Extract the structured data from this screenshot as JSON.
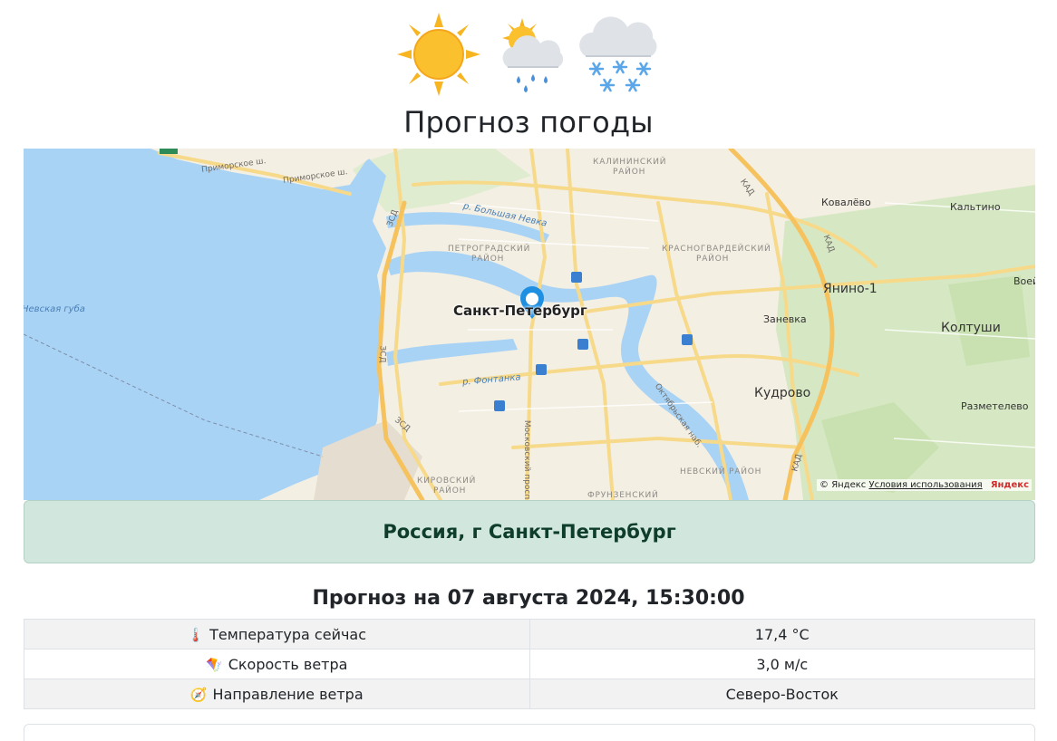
{
  "header": {
    "icons": [
      "sun-icon",
      "sun-behind-rain-cloud-icon",
      "snow-cloud-icon"
    ],
    "title": "Прогноз погоды"
  },
  "map": {
    "labels": {
      "primorskoe_sh_1": "Приморское ш.",
      "primorskoe_sh_2": "Приморское ш.",
      "kalininsky": "Калининский",
      "kalininsky_2": "район",
      "petrogradsky": "Петроградский",
      "petrogradsky_2": "район",
      "krasnogvardeysky": "Красногвардейский",
      "krasnogvardeysky_2": "район",
      "kirovsky": "Кировский",
      "kirovsky_2": "район",
      "nevsky": "Невский район",
      "frunzensky": "Фрунзенский",
      "b_nevka": "р. Большая Невка",
      "fontanka": "р. Фонтанка",
      "nevskaya_guba": "Невская губа",
      "zsd_1": "ЗСД",
      "zsd_2": "ЗСД",
      "zsd_3": "ЗСД",
      "kad_1": "КАД",
      "kad_2": "КАД",
      "kad_3": "КАД",
      "moskovsky": "Московский просп.",
      "oktyabrskaya": "Октябрьская наб.",
      "city": "Санкт-Петербург",
      "kovalevo": "Ковалёво",
      "kaltino": "Кальтино",
      "yanino": "Янино-1",
      "voeykovo": "Воей",
      "koltushi": "Колтуши",
      "zanevka": "Заневка",
      "kudrovo": "Кудрово",
      "razmetelevo": "Разметелево"
    },
    "copyright": "© Яндекс",
    "terms": "Условия использования",
    "brand": "Яндекс",
    "colors": {
      "water": "#a9d3f5",
      "land": "#f4efe3",
      "green": "#d6e8c3",
      "road": "#f7d98a"
    }
  },
  "location": {
    "text": "Россия, г Санкт-Петербург",
    "color": "#d1e7dd"
  },
  "forecast": {
    "heading": "Прогноз на 07 августа 2024, 15:30:00",
    "rows": [
      {
        "icon": "thermometer-icon",
        "glyph": "🌡️",
        "label": "Температура сейчас",
        "value": "17,4 °C"
      },
      {
        "icon": "kite-icon",
        "glyph": "🪁",
        "label": "Скорость ветра",
        "value": "3,0 м/с"
      },
      {
        "icon": "compass-icon",
        "glyph": "🧭",
        "label": "Направление ветра",
        "value": "Северо-Восток"
      }
    ]
  }
}
